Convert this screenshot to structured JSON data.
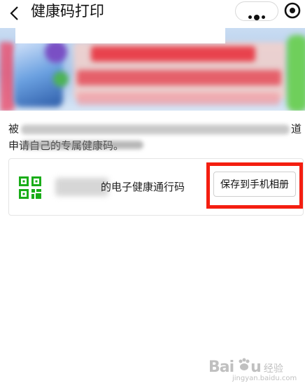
{
  "header": {
    "title": "健康码打印",
    "back_icon": "chevron-left-icon",
    "more_icon": "more-dots-icon",
    "close_icon": "target-close-icon"
  },
  "intro": {
    "line1_start": "被",
    "line1_end": "道",
    "line2_end": "申请自己的专属健康码。"
  },
  "card": {
    "title_suffix": "的电子健康通行码",
    "save_button": "保存到手机相册",
    "qr_color": "#1aad19",
    "highlight_color": "#f41e10"
  },
  "watermark": {
    "brand": "Bai",
    "brand2": "u",
    "word": "经验",
    "url": "jingyan.baidu.com"
  }
}
